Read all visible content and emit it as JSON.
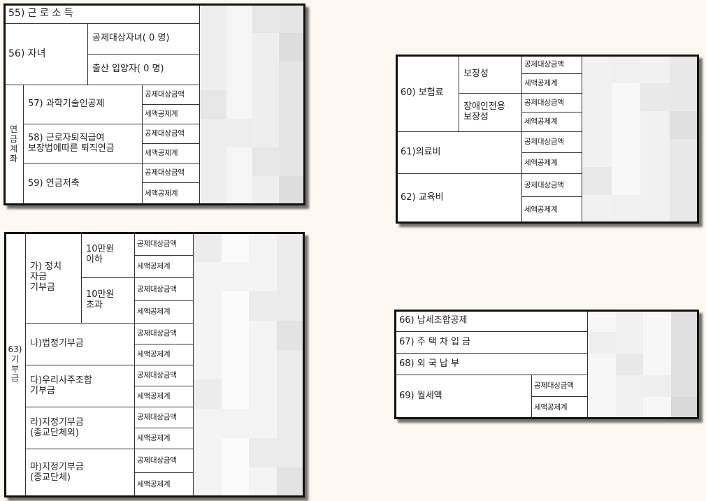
{
  "panels": [
    {
      "id": "earned-income-pension",
      "rows": {
        "r55": "55) 근 로 소 득",
        "r56": "56) 자녀",
        "r56a": "공제대상자녀( 0 명)",
        "r56b": "출산 입양자( 0 명)",
        "pension_group": "연\n금\n계\n좌",
        "r57": "57) 과학기술인공제",
        "r58": "58) 근로자퇴직급여\n보장법에따른 퇴직연금",
        "r59": "59) 연금저축"
      }
    },
    {
      "id": "insurance-medical-education",
      "rows": {
        "r60": "60) 보험료",
        "r60a": "보장성",
        "r60b": "장애인전용\n보장성",
        "r61": "61)의료비",
        "r62": "62) 교육비"
      }
    },
    {
      "id": "donations",
      "rows": {
        "r63": "63)\n기\n부\n금",
        "ga": "가) 정치\n자금\n기부금",
        "ga1": "10만원\n이하",
        "ga2": "10만원\n초과",
        "na": "나)법정기부금",
        "da": "다)우리사주조합\n기부금",
        "ra": "라)지정기부금\n(종교단체외)",
        "ma": "마)지정기부금\n(종교단체)"
      }
    },
    {
      "id": "other-credits",
      "rows": {
        "r66": "66) 납세조합공제",
        "r67": "67) 주 택 차 입 금",
        "r68": "68) 외 국 납 부",
        "r69": "69) 월세액"
      }
    }
  ],
  "labels": {
    "amount": "공제대상금액",
    "credit": "세액공제계"
  }
}
